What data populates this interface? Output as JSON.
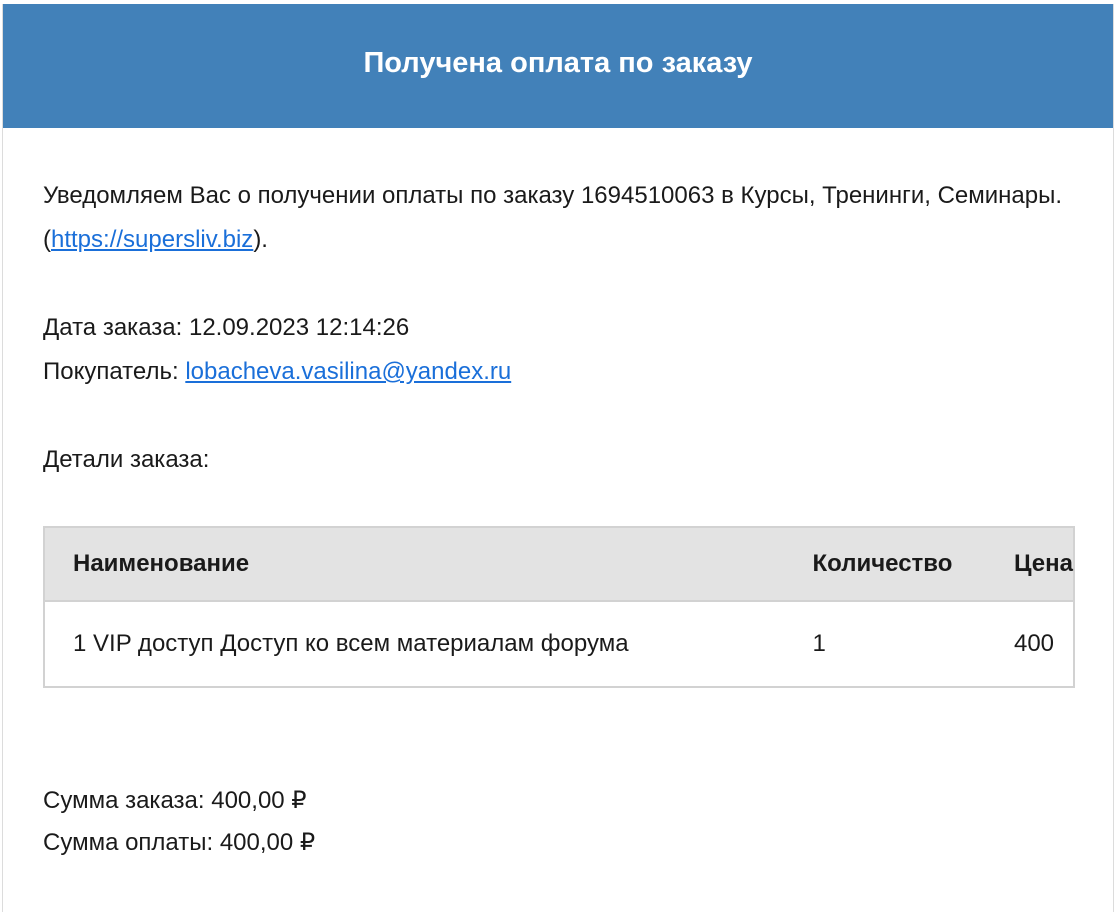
{
  "header": {
    "title": "Получена оплата по заказу"
  },
  "intro": {
    "text_before_link": "Уведомляем Вас о получении оплаты по заказу 1694510063 в Курсы, Тренинги, Семинары. (",
    "link": "https://supersliv.biz",
    "text_after_link": ")."
  },
  "meta": {
    "date_label": "Дата заказа:",
    "date_value": "12.09.2023 12:14:26",
    "buyer_label": "Покупатель:",
    "buyer_email": "lobacheva.vasilina@yandex.ru"
  },
  "details": {
    "title": "Детали заказа:",
    "columns": [
      "Наименование",
      "Количество",
      "Цена"
    ],
    "rows": [
      {
        "name": "1 VIP доступ Доступ ко всем материалам форума",
        "quantity": "1",
        "price": "400"
      }
    ]
  },
  "summary": {
    "order_total_label": "Сумма заказа:",
    "order_total_value": "400,00 ₽",
    "paid_total_label": "Сумма оплаты:",
    "paid_total_value": "400,00 ₽"
  },
  "colors": {
    "header_bg": "#4281b9",
    "link": "#1a6fd9",
    "table_header_bg": "#e3e3e3"
  }
}
